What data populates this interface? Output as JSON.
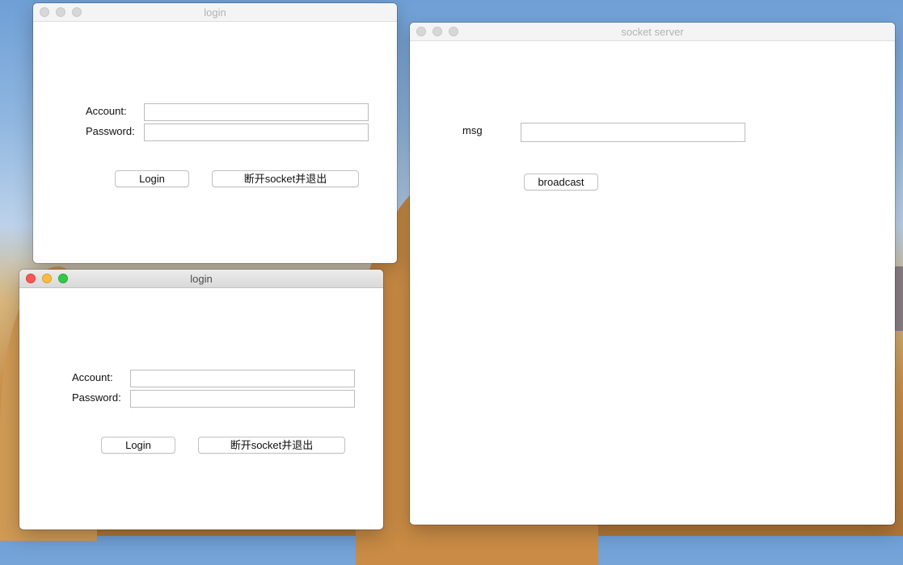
{
  "windows": [
    {
      "title": "login",
      "account_label": "Account:",
      "account_value": "",
      "password_label": "Password:",
      "password_value": "",
      "login_button": "Login",
      "disconnect_button": "断开socket并退出"
    },
    {
      "title": "login",
      "account_label": "Account:",
      "account_value": "",
      "password_label": "Password:",
      "password_value": "",
      "login_button": "Login",
      "disconnect_button": "断开socket并退出"
    }
  ],
  "server": {
    "title": "socket server",
    "msg_label": "msg",
    "msg_value": "",
    "broadcast_button": "broadcast"
  },
  "colors": {
    "close": "#fc5753",
    "minimize": "#fdbc40",
    "zoom": "#34c84a"
  }
}
